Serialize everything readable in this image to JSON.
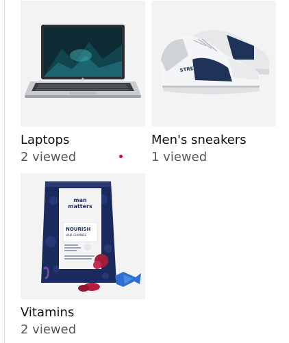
{
  "categories": [
    {
      "label": "Laptops",
      "count": "2 viewed",
      "icon": "laptop-image"
    },
    {
      "label": "Men's sneakers",
      "count": "1 viewed",
      "icon": "sneaker-image"
    },
    {
      "label": "Vitamins",
      "count": "2 viewed",
      "icon": "vitamin-pack-image",
      "product": {
        "brand_line1": "man",
        "brand_line2": "matters",
        "title": "NOURISH",
        "subtitle": "HAIR GUMMIES"
      }
    }
  ],
  "colors": {
    "tile_bg": "#f3f3f3",
    "count_text": "#565959",
    "indicator": "#cc0c39"
  }
}
